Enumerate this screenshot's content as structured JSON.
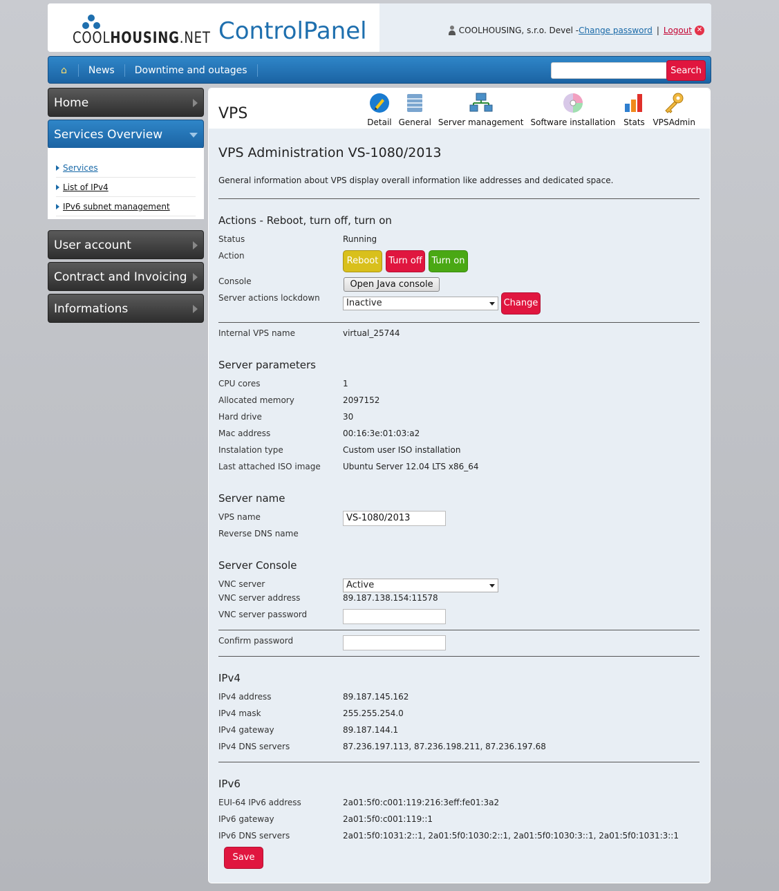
{
  "header": {
    "logo_text_light": "COOL",
    "logo_text_bold": "HOUSING",
    "logo_text_suffix": ".NET",
    "app_title": "ControlPanel",
    "user_name": "COOLHOUSING, s.r.o. Devel -",
    "change_password": "Change password",
    "separator": "|",
    "logout": "Logout"
  },
  "nav": {
    "home_icon": "home-icon",
    "items": [
      "News",
      "Downtime and outages"
    ],
    "search_placeholder": "",
    "search_button": "Search"
  },
  "sidebar": {
    "home": "Home",
    "services_overview": "Services Overview",
    "submenu": [
      "Services",
      "List of IPv4",
      "IPv6 subnet management"
    ],
    "user_account": "User account",
    "contract": "Contract and Invoicing",
    "informations": "Informations"
  },
  "main": {
    "title": "VPS",
    "toolbar": [
      "Detail",
      "General",
      "Server management",
      "Software installation",
      "Stats",
      "VPSAdmin"
    ],
    "heading": "VPS Administration VS-1080/2013",
    "description": "General information about VPS display overall information like addresses and dedicated space.",
    "actions": {
      "title": "Actions - Reboot, turn off, turn on",
      "status_label": "Status",
      "status_value": "Running",
      "action_label": "Action",
      "reboot": "Reboot",
      "turn_off": "Turn off",
      "turn_on": "Turn on",
      "console_label": "Console",
      "console_button": "Open Java console",
      "lockdown_label": "Server actions lockdown",
      "lockdown_value": "Inactive",
      "change_button": "Change"
    },
    "internal_name_label": "Internal VPS name",
    "internal_name_value": "virtual_25744",
    "params": {
      "title": "Server parameters",
      "rows": [
        {
          "label": "CPU cores",
          "value": "1"
        },
        {
          "label": "Allocated memory",
          "value": "2097152"
        },
        {
          "label": "Hard drive",
          "value": "30"
        },
        {
          "label": "Mac address",
          "value": "00:16:3e:01:03:a2"
        },
        {
          "label": "Instalation type",
          "value": "Custom user ISO installation"
        },
        {
          "label": "Last attached ISO image",
          "value": "Ubuntu Server 12.04 LTS x86_64"
        }
      ]
    },
    "server_name": {
      "title": "Server name",
      "vps_name_label": "VPS name",
      "vps_name_value": "VS-1080/2013",
      "rdns_label": "Reverse DNS name"
    },
    "console": {
      "title": "Server Console",
      "vnc_label": "VNC server",
      "vnc_value": "Active",
      "vnc_address_label": "VNC server address",
      "vnc_address_value": "89.187.138.154:11578",
      "vnc_password_label": "VNC server password",
      "confirm_label": "Confirm password"
    },
    "ipv4": {
      "title": "IPv4",
      "rows": [
        {
          "label": "IPv4 address",
          "value": "89.187.145.162"
        },
        {
          "label": "IPv4 mask",
          "value": "255.255.254.0"
        },
        {
          "label": "IPv4 gateway",
          "value": "89.187.144.1"
        },
        {
          "label": "IPv4 DNS servers",
          "value": "87.236.197.113, 87.236.198.211, 87.236.197.68"
        }
      ]
    },
    "ipv6": {
      "title": "IPv6",
      "rows": [
        {
          "label": "EUI-64 IPv6 address",
          "value": "2a01:5f0:c001:119:216:3eff:fe01:3a2"
        },
        {
          "label": "IPv6 gateway",
          "value": "2a01:5f0:c001:119::1"
        },
        {
          "label": "IPv6 DNS servers",
          "value": "2a01:5f0:1031:2::1, 2a01:5f0:1030:2::1, 2a01:5f0:1030:3::1, 2a01:5f0:1031:3::1"
        }
      ]
    },
    "save_button": "Save"
  }
}
